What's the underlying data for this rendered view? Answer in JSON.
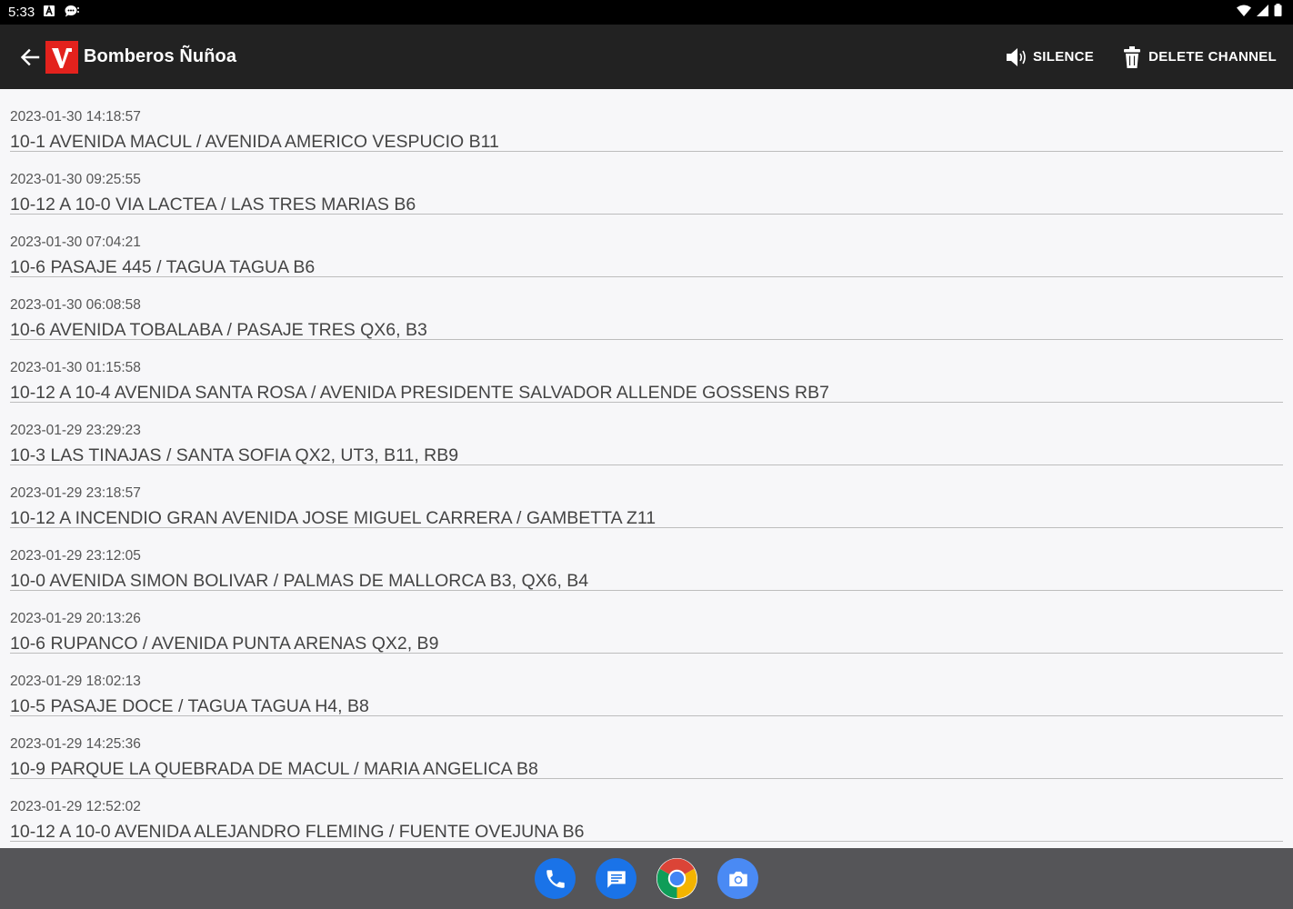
{
  "status_bar": {
    "time": "5:33"
  },
  "app_bar": {
    "title": "Bomberos Ñuñoa",
    "silence_label": "SILENCE",
    "delete_label": "DELETE CHANNEL"
  },
  "colors": {
    "logo_red": "#e3221d",
    "app_bar_bg": "#222222",
    "list_bg": "#f7f7f9",
    "divider": "#bdbdbd"
  },
  "icons": {
    "back": "arrow-back-icon",
    "silence": "volume-icon",
    "delete": "trash-icon",
    "dock": [
      "phone-icon",
      "messages-icon",
      "chrome-icon",
      "camera-icon"
    ]
  },
  "messages": [
    {
      "time": "2023-01-30 14:18:57",
      "text": "10-1 AVENIDA MACUL / AVENIDA AMERICO VESPUCIO B11"
    },
    {
      "time": "2023-01-30 09:25:55",
      "text": "10-12 A 10-0 VIA LACTEA / LAS TRES MARIAS B6"
    },
    {
      "time": "2023-01-30 07:04:21",
      "text": "10-6 PASAJE 445 / TAGUA TAGUA B6"
    },
    {
      "time": "2023-01-30 06:08:58",
      "text": "10-6 AVENIDA TOBALABA / PASAJE TRES QX6, B3"
    },
    {
      "time": "2023-01-30 01:15:58",
      "text": "10-12 A 10-4 AVENIDA SANTA ROSA / AVENIDA PRESIDENTE SALVADOR ALLENDE GOSSENS RB7"
    },
    {
      "time": "2023-01-29 23:29:23",
      "text": "10-3 LAS TINAJAS / SANTA SOFIA QX2, UT3, B11, RB9"
    },
    {
      "time": "2023-01-29 23:18:57",
      "text": "10-12 A INCENDIO GRAN AVENIDA JOSE MIGUEL CARRERA / GAMBETTA Z11"
    },
    {
      "time": "2023-01-29 23:12:05",
      "text": "10-0 AVENIDA SIMON BOLIVAR / PALMAS DE MALLORCA B3, QX6, B4"
    },
    {
      "time": "2023-01-29 20:13:26",
      "text": "10-6 RUPANCO / AVENIDA PUNTA ARENAS QX2, B9"
    },
    {
      "time": "2023-01-29 18:02:13",
      "text": "10-5 PASAJE DOCE / TAGUA TAGUA H4, B8"
    },
    {
      "time": "2023-01-29 14:25:36",
      "text": "10-9 PARQUE LA QUEBRADA DE MACUL / MARIA ANGELICA B8"
    },
    {
      "time": "2023-01-29 12:52:02",
      "text": "10-12 A 10-0 AVENIDA ALEJANDRO FLEMING / FUENTE OVEJUNA B6"
    }
  ]
}
